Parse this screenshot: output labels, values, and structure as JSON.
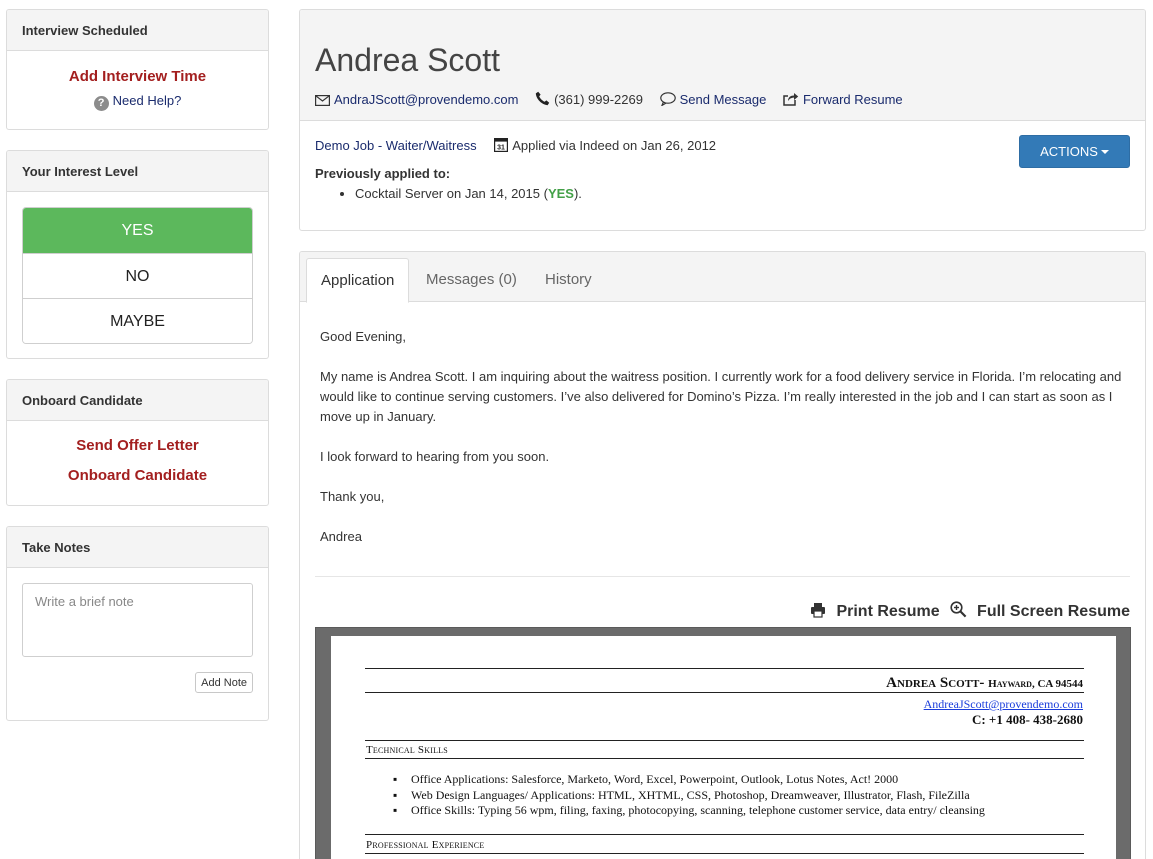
{
  "sidebar": {
    "interview": {
      "title": "Interview Scheduled",
      "add_time": "Add Interview Time",
      "help": "Need Help?"
    },
    "interest": {
      "title": "Your Interest Level",
      "options": [
        "YES",
        "NO",
        "MAYBE"
      ],
      "selected": "YES"
    },
    "onboard": {
      "title": "Onboard Candidate",
      "send_offer": "Send Offer Letter",
      "onboard": "Onboard Candidate"
    },
    "notes": {
      "title": "Take Notes",
      "placeholder": "Write a brief note",
      "add_label": "Add Note"
    }
  },
  "candidate": {
    "name": "Andrea Scott",
    "email": "AndraJScott@provendemo.com",
    "phone": "(361) 999-2269",
    "send_message": "Send Message",
    "forward_resume": "Forward Resume",
    "job": "Demo Job - Waiter/Waitress",
    "calendar_day": "31",
    "applied": "Applied via Indeed on Jan 26, 2012",
    "actions_label": "ACTIONS",
    "previously_applied_label": "Previously applied to:",
    "previous": {
      "text": "Cocktail Server on Jan 14, 2015 (",
      "status": "YES",
      "suffix": ")."
    }
  },
  "application": {
    "tabs": [
      "Application",
      "Messages (0)",
      "History"
    ],
    "active_tab": "Application",
    "letter": [
      "Good Evening,",
      "My name is Andrea Scott. I am inquiring about the waitress position. I currently work for a food delivery service in Florida. I’m relocating and would like to continue serving customers. I’ve also delivered for Domino’s Pizza. I’m really interested in the job and I can start as soon as I move up in January.",
      "I look forward to hearing from you soon.",
      "Thank you,",
      "Andrea"
    ],
    "print_resume": "Print Resume",
    "full_screen_resume": "Full Screen Resume"
  },
  "resume": {
    "name": "Andrea Scott",
    "location": "Hayward, CA 94544",
    "email": "AndreaJScott@provendemo.com",
    "phone": "C: +1 408- 438-2680",
    "technical_skills_title": "Technical Skills",
    "skills": [
      "Office Applications: Salesforce, Marketo, Word, Excel, Powerpoint, Outlook, Lotus Notes, Act! 2000",
      "Web Design Languages/ Applications: HTML, XHTML, CSS, Photoshop, Dreamweaver, Illustrator, Flash, FileZilla",
      "Office Skills: Typing 56 wpm, filing, faxing, photocopying, scanning, telephone customer service, data entry/ cleansing"
    ],
    "experience_title": "Professional Experience"
  },
  "colors": {
    "accent_red": "#a31f1f",
    "yes_green": "#5cb85c",
    "actions_blue": "#337ab7",
    "link_navy": "#1a2b6d"
  }
}
